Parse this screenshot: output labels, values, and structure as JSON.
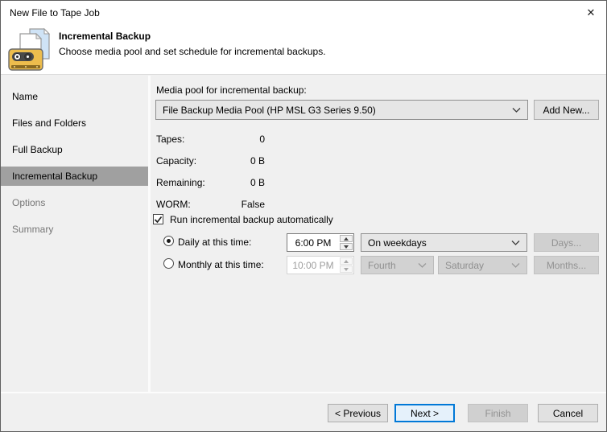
{
  "window": {
    "title": "New File to Tape Job",
    "close_glyph": "✕"
  },
  "header": {
    "title": "Incremental Backup",
    "description": "Choose media pool and set schedule for incremental backups."
  },
  "sidebar": {
    "items": [
      {
        "label": "Name",
        "state": "done"
      },
      {
        "label": "Files and Folders",
        "state": "done"
      },
      {
        "label": "Full Backup",
        "state": "done"
      },
      {
        "label": "Incremental Backup",
        "state": "active"
      },
      {
        "label": "Options",
        "state": "upcoming"
      },
      {
        "label": "Summary",
        "state": "upcoming"
      }
    ]
  },
  "main": {
    "media_pool_label": "Media pool for incremental backup:",
    "media_pool_value": "File Backup Media Pool (HP MSL G3 Series 9.50)",
    "add_new_label": "Add New...",
    "stats": [
      {
        "label": "Tapes:",
        "value": "0"
      },
      {
        "label": "Capacity:",
        "value": "0 B"
      },
      {
        "label": "Remaining:",
        "value": "0 B"
      },
      {
        "label": "WORM:",
        "value": "False"
      }
    ],
    "auto_checkbox": {
      "label": "Run incremental backup automatically",
      "checked": true
    },
    "daily": {
      "label": "Daily at this time:",
      "selected": true,
      "time": "6:00 PM",
      "frequency": "On weekdays",
      "days_button": "Days...",
      "days_button_enabled": false
    },
    "monthly": {
      "label": "Monthly at this time:",
      "selected": false,
      "time": "10:00 PM",
      "week": "Fourth",
      "day": "Saturday",
      "months_button": "Months...",
      "controls_enabled": false
    }
  },
  "footer": {
    "previous": "< Previous",
    "next": "Next >",
    "finish": "Finish",
    "cancel": "Cancel",
    "next_is_default": true,
    "finish_enabled": false
  },
  "colors": {
    "accent": "#0078d7",
    "default_button_bg": "#e5f1fb",
    "sidebar_active_bg": "#a0a0a0",
    "content_bg": "#f0f0f0",
    "header_bg": "#ffffff"
  }
}
